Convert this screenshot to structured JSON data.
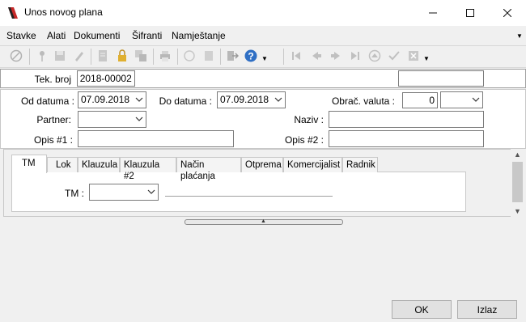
{
  "window": {
    "title": "Unos novog plana",
    "minimize_icon": "minimize-icon",
    "maximize_icon": "maximize-icon",
    "close_icon": "close-icon"
  },
  "menu": {
    "items": [
      "Stavke",
      "Alati",
      "Dokumenti",
      "Šifranti",
      "Namještanje"
    ]
  },
  "toolbar": {
    "icons": [
      "cancel-icon",
      "pin-icon",
      "save-icon",
      "edit-icon",
      "document-icon",
      "lock-icon",
      "copy-icon",
      "print-icon",
      "export-icon",
      "page-icon",
      "exit-icon",
      "help-icon",
      "first-icon",
      "prev-icon",
      "next-icon",
      "last-icon",
      "up-icon",
      "check-icon",
      "delete-icon"
    ]
  },
  "form": {
    "tek_broj_label": "Tek. broj",
    "tek_broj_value": "2018-00002",
    "od_datuma_label": "Od datuma :",
    "od_datuma_value": "07.09.2018",
    "do_datuma_label": "Do datuma :",
    "do_datuma_value": "07.09.2018",
    "obrac_valuta_label": "Obrač. valuta :",
    "obrac_valuta_value": "0",
    "partner_label": "Partner:",
    "naziv_label": "Naziv :",
    "opis1_label": "Opis #1 :",
    "opis2_label": "Opis #2 :"
  },
  "tabs": {
    "items": [
      "TM",
      "Lok",
      "Klauzula",
      "Klauzula #2",
      "Način plaćanja",
      "Otprema",
      "Komercijalist",
      "Radnik"
    ],
    "active": "TM",
    "tm_label": "TM :"
  },
  "buttons": {
    "ok": "OK",
    "izlaz": "Izlaz"
  }
}
